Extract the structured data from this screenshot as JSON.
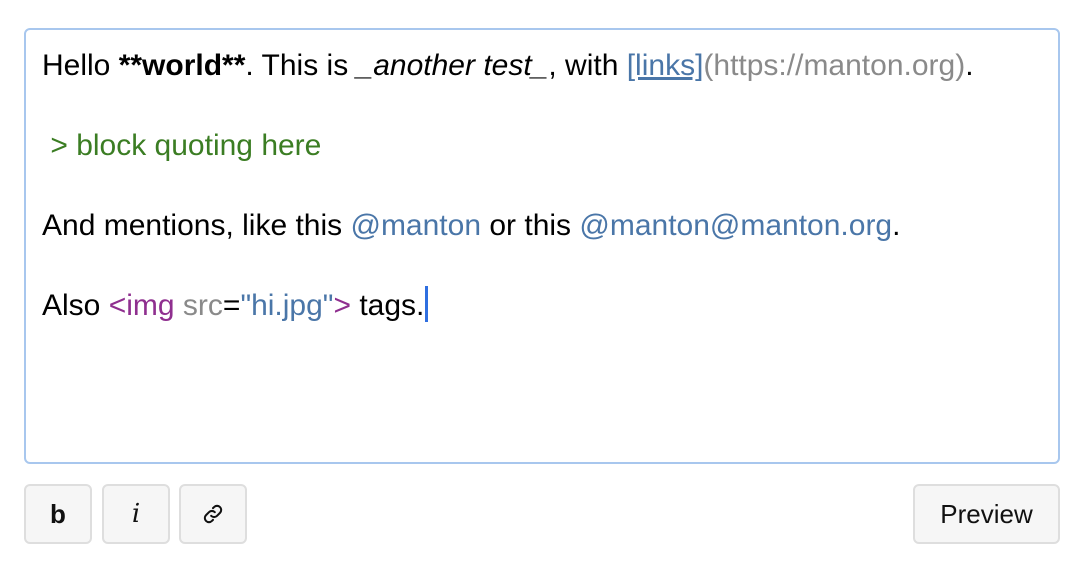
{
  "editor": {
    "line1": {
      "t1": "Hello ",
      "bold": "**world**",
      "t2": ". This is ",
      "italic": "_another test_",
      "t3": ", with ",
      "link_text": "[links]",
      "link_url": "(https://manton.org)",
      "t4": "."
    },
    "quote": " > block quoting here",
    "line3": {
      "t1": "And mentions, like this ",
      "mention1": "@manton",
      "t2": " or this ",
      "mention2": "@manton@manton.org",
      "t3": "."
    },
    "line4": {
      "t1": "Also ",
      "tag_open": "<img",
      "sp": " ",
      "attr": "src",
      "eq": "=",
      "value": "\"hi.jpg\"",
      "tag_close": ">",
      "t2": " tags."
    }
  },
  "toolbar": {
    "bold_label": "b",
    "italic_label": "i",
    "link_icon": "link-icon",
    "preview_label": "Preview"
  },
  "colors": {
    "border_focus": "#a8c7ee",
    "link": "#4a76a8",
    "quote": "#3b7d23",
    "tag": "#8f2f8f",
    "muted": "#8a8a8a",
    "caret": "#2f6fe0"
  }
}
